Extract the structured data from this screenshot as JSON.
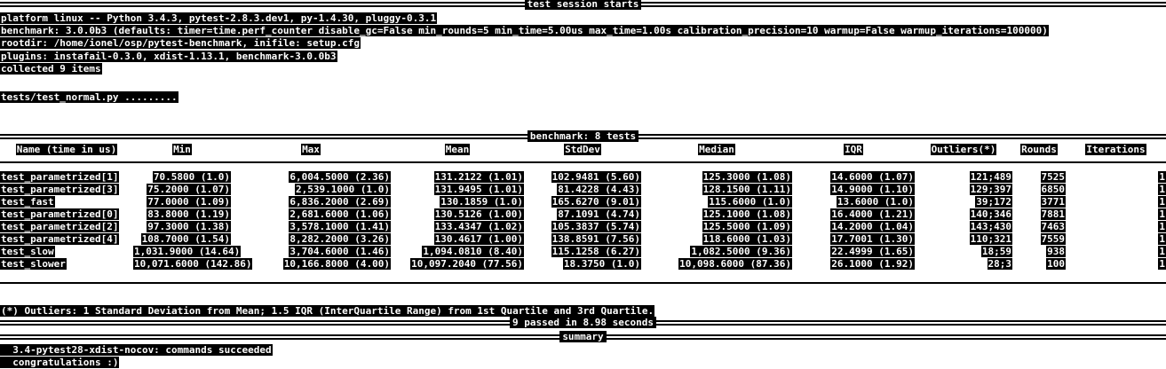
{
  "session": {
    "title": "test session starts",
    "platform": "platform linux -- Python 3.4.3, pytest-2.8.3.dev1, py-1.4.30, pluggy-0.3.1",
    "benchmark": "benchmark: 3.0.0b3 (defaults: timer=time.perf_counter disable_gc=False min_rounds=5 min_time=5.00us max_time=1.00s calibration_precision=10 warmup=False warmup_iterations=100000)",
    "rootdir": "rootdir: /home/ionel/osp/pytest-benchmark, inifile: setup.cfg",
    "plugins": "plugins: instafail-0.3.0, xdist-1.13.1, benchmark-3.0.0b3",
    "collected": "collected 9 items",
    "test_file": "tests/test_normal.py ........."
  },
  "bench": {
    "title": "benchmark: 8 tests",
    "headers": [
      "Name (time in us)",
      "Min",
      "Max",
      "Mean",
      "StdDev",
      "Median",
      "IQR",
      "Outliers(*)",
      "Rounds",
      "Iterations"
    ],
    "rows": [
      [
        "test_parametrized[1]",
        "70.5800 (1.0)",
        "6,004.5000 (2.36)",
        "131.2122 (1.01)",
        "102.9481 (5.60)",
        "125.3000 (1.08)",
        "14.6000 (1.07)",
        "121;489",
        "7525",
        "1"
      ],
      [
        "test_parametrized[3]",
        "75.2000 (1.07)",
        "2,539.1000 (1.0)",
        "131.9495 (1.01)",
        "81.4228 (4.43)",
        "128.1500 (1.11)",
        "14.9000 (1.10)",
        "129;397",
        "6850",
        "1"
      ],
      [
        "test_fast",
        "77.0000 (1.09)",
        "6,836.2000 (2.69)",
        "130.1859 (1.0)",
        "165.6270 (9.01)",
        "115.6000 (1.0)",
        "13.6000 (1.0)",
        "39;172",
        "3771",
        "1"
      ],
      [
        "test_parametrized[0]",
        "83.8000 (1.19)",
        "2,681.6000 (1.06)",
        "130.5126 (1.00)",
        "87.1091 (4.74)",
        "125.1000 (1.08)",
        "16.4000 (1.21)",
        "140;346",
        "7881",
        "1"
      ],
      [
        "test_parametrized[2]",
        "97.3000 (1.38)",
        "3,578.1000 (1.41)",
        "133.4347 (1.02)",
        "105.3837 (5.74)",
        "125.5000 (1.09)",
        "14.2000 (1.04)",
        "143;430",
        "7463",
        "1"
      ],
      [
        "test_parametrized[4]",
        "108.7000 (1.54)",
        "8,282.2000 (3.26)",
        "130.4617 (1.00)",
        "138.8591 (7.56)",
        "118.6000 (1.03)",
        "17.7001 (1.30)",
        "110;321",
        "7559",
        "1"
      ],
      [
        "test_slow",
        "1,031.9000 (14.64)",
        "3,704.6000 (1.46)",
        "1,094.0810 (8.40)",
        "115.1258 (6.27)",
        "1,082.5000 (9.36)",
        "22.4999 (1.65)",
        "18;59",
        "938",
        "1"
      ],
      [
        "test_slower",
        "10,071.6000 (142.86)",
        "10,166.8000 (4.00)",
        "10,097.2040 (77.56)",
        "18.3750 (1.0)",
        "10,098.6000 (87.36)",
        "26.1000 (1.92)",
        "28;3",
        "100",
        "1"
      ]
    ],
    "footnote": "(*) Outliers: 1 Standard Deviation from Mean; 1.5 IQR (InterQuartile Range) from 1st Quartile and 3rd Quartile."
  },
  "result": {
    "passed": "9 passed in 8.98 seconds"
  },
  "summary": {
    "title": "summary",
    "line1": "  3.4-pytest28-xdist-nocov: commands succeeded",
    "line2": "  congratulations :)"
  }
}
